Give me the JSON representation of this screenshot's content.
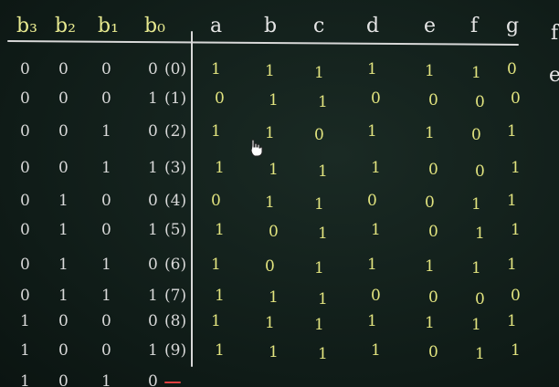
{
  "input_headers": [
    "b3",
    "b2",
    "b1",
    "b0"
  ],
  "input_header_display": [
    "b₃",
    "b₂",
    "b₁",
    "b₀"
  ],
  "output_headers": [
    "a",
    "b",
    "c",
    "d",
    "e",
    "f",
    "g"
  ],
  "edge_headers": [
    "f",
    "e"
  ],
  "colors": {
    "board": "#0f1b17",
    "chalk_white": "#d9d9d9",
    "chalk_yellow": "#e2e47f"
  },
  "rows": [
    {
      "inputs": [
        "0",
        "0",
        "0",
        "0"
      ],
      "index": "(0)",
      "outputs": [
        "1",
        "1",
        "1",
        "1",
        "1",
        "1",
        "0"
      ]
    },
    {
      "inputs": [
        "0",
        "0",
        "0",
        "1"
      ],
      "index": "(1)",
      "outputs": [
        "0",
        "1",
        "1",
        "0",
        "0",
        "0",
        "0"
      ]
    },
    {
      "inputs": [
        "0",
        "0",
        "1",
        "0"
      ],
      "index": "(2)",
      "outputs": [
        "1",
        "1",
        "0",
        "1",
        "1",
        "0",
        "1"
      ]
    },
    {
      "inputs": [
        "0",
        "0",
        "1",
        "1"
      ],
      "index": "(3)",
      "outputs": [
        "1",
        "1",
        "1",
        "1",
        "0",
        "0",
        "1"
      ]
    },
    {
      "inputs": [
        "0",
        "1",
        "0",
        "0"
      ],
      "index": "(4)",
      "outputs": [
        "0",
        "1",
        "1",
        "0",
        "0",
        "1",
        "1"
      ]
    },
    {
      "inputs": [
        "0",
        "1",
        "0",
        "1"
      ],
      "index": "(5)",
      "outputs": [
        "1",
        "0",
        "1",
        "1",
        "0",
        "1",
        "1"
      ]
    },
    {
      "inputs": [
        "0",
        "1",
        "1",
        "0"
      ],
      "index": "(6)",
      "outputs": [
        "1",
        "0",
        "1",
        "1",
        "1",
        "1",
        "1"
      ]
    },
    {
      "inputs": [
        "0",
        "1",
        "1",
        "1"
      ],
      "index": "(7)",
      "outputs": [
        "1",
        "1",
        "1",
        "0",
        "0",
        "0",
        "0"
      ]
    },
    {
      "inputs": [
        "1",
        "0",
        "0",
        "0"
      ],
      "index": "(8)",
      "outputs": [
        "1",
        "1",
        "1",
        "1",
        "1",
        "1",
        "1"
      ]
    },
    {
      "inputs": [
        "1",
        "0",
        "0",
        "1"
      ],
      "index": "(9)",
      "outputs": [
        "1",
        "1",
        "1",
        "1",
        "0",
        "1",
        "1"
      ]
    },
    {
      "inputs": [
        "1",
        "0",
        "1",
        "0"
      ],
      "index": "",
      "outputs": []
    }
  ]
}
